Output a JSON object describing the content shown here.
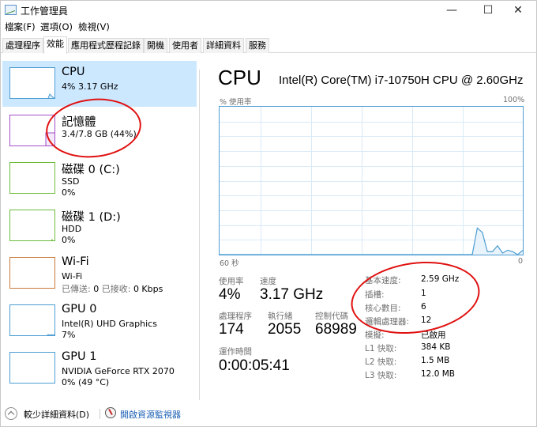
{
  "window": {
    "title": "工作管理員",
    "controls": {
      "minimize": "—",
      "maximize": "☐",
      "close": "✕"
    }
  },
  "menu": [
    "檔案(F)",
    "選項(O)",
    "檢視(V)"
  ],
  "tabs": [
    {
      "label": "處理程序",
      "active": false
    },
    {
      "label": "效能",
      "active": true
    },
    {
      "label": "應用程式歷程記錄",
      "active": false
    },
    {
      "label": "開機",
      "active": false
    },
    {
      "label": "使用者",
      "active": false
    },
    {
      "label": "詳細資料",
      "active": false
    },
    {
      "label": "服務",
      "active": false
    }
  ],
  "resources": [
    {
      "name": "CPU",
      "line1": "4% 3.17 GHz",
      "line2": "",
      "color": "#4c9dd2",
      "selected": true
    },
    {
      "name": "記憶體",
      "line1": "3.4/7.8 GB (44%)",
      "line2": "",
      "color": "#a24ec8",
      "selected": false
    },
    {
      "name": "磁碟 0 (C:)",
      "line1": "SSD",
      "line2": "0%",
      "color": "#6cbb3c",
      "selected": false
    },
    {
      "name": "磁碟 1 (D:)",
      "line1": "HDD",
      "line2": "0%",
      "color": "#6cbb3c",
      "selected": false
    },
    {
      "name": "Wi-Fi",
      "line1": "Wi-Fi",
      "line2_label_sent": "已傳送:",
      "line2_sent": "0",
      "line2_label_recv": "已接收:",
      "line2_recv": "0 Kbps",
      "color": "#c87a3c",
      "selected": false
    },
    {
      "name": "GPU 0",
      "line1": "Intel(R) UHD Graphics",
      "line2": "7%",
      "color": "#4c9dd2",
      "selected": false
    },
    {
      "name": "GPU 1",
      "line1": "NVIDIA GeForce RTX 2070",
      "line2": "0% (49 °C)",
      "color": "#4c9dd2",
      "selected": false
    }
  ],
  "detail": {
    "title": "CPU",
    "model": "Intel(R) Core(TM) i7-10750H CPU @ 2.60GHz",
    "graph": {
      "y_label": "% 使用率",
      "y_max_label": "100%",
      "x_left_label": "60 秒",
      "x_right_label": "0",
      "line_color": "#4c9dd2",
      "grid_color": "#d9eaf7"
    },
    "stats": {
      "usage_label": "使用率",
      "usage": "4%",
      "speed_label": "速度",
      "speed": "3.17 GHz",
      "processes_label": "處理程序",
      "processes": "174",
      "threads_label": "執行緒",
      "threads": "2055",
      "handles_label": "控制代碼",
      "handles": "68989",
      "uptime_label": "運作時間",
      "uptime": "0:00:05:41"
    },
    "specs": [
      {
        "label": "基本速度:",
        "value": "2.59 GHz"
      },
      {
        "label": "插槽:",
        "value": "1"
      },
      {
        "label": "核心數目:",
        "value": "6"
      },
      {
        "label": "邏輯處理器:",
        "value": "12"
      },
      {
        "label": "模擬:",
        "value": "已啟用"
      },
      {
        "label": "L1 快取:",
        "value": "384 KB"
      },
      {
        "label": "L2 快取:",
        "value": "1.5 MB"
      },
      {
        "label": "L3 快取:",
        "value": "12.0 MB"
      }
    ]
  },
  "chart_data": {
    "type": "area",
    "title": "CPU % 使用率",
    "xlabel": "秒",
    "ylabel": "% 使用率",
    "x_range_seconds": [
      60,
      0
    ],
    "ylim": [
      0,
      100
    ],
    "grid": true,
    "grid_divisions": {
      "x": 6,
      "y": 10
    },
    "x": [
      60,
      59,
      58,
      57,
      56,
      55,
      54,
      53,
      52,
      51,
      50,
      49,
      48,
      47,
      46,
      45,
      44,
      43,
      42,
      41,
      40,
      39,
      38,
      37,
      36,
      35,
      34,
      33,
      32,
      31,
      30,
      29,
      28,
      27,
      26,
      25,
      24,
      23,
      22,
      21,
      20,
      19,
      18,
      17,
      16,
      15,
      14,
      13,
      12,
      11,
      10,
      9,
      8,
      7,
      6,
      5,
      4,
      3,
      2,
      1,
      0
    ],
    "values": [
      0,
      0,
      0,
      0,
      0,
      0,
      0,
      0,
      0,
      0,
      0,
      0,
      0,
      0,
      0,
      0,
      0,
      0,
      0,
      0,
      0,
      0,
      0,
      0,
      0,
      0,
      0,
      0,
      0,
      0,
      0,
      0,
      0,
      0,
      0,
      0,
      0,
      0,
      0,
      0,
      0,
      0,
      0,
      0,
      0,
      0,
      0,
      0,
      0,
      0,
      0,
      18,
      15,
      2,
      2,
      6,
      1,
      3,
      2,
      0,
      3
    ]
  },
  "footer": {
    "fewer_details": "較少詳細資料(D)",
    "resource_monitor": "開啟資源監視器"
  },
  "annotations": {
    "color": "#e01010"
  }
}
